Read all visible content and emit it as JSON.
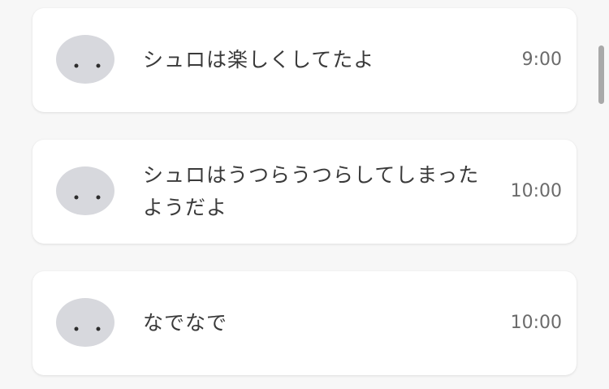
{
  "feed": {
    "items": [
      {
        "message": "シュロは楽しくしてたよ",
        "time": "9:00"
      },
      {
        "message": "シュロはうつらうつらしてしまったようだよ",
        "time": "10:00"
      },
      {
        "message": "なでなで",
        "time": "10:00"
      }
    ]
  },
  "theme": {
    "background": "#f7f7f7",
    "card": "#ffffff",
    "avatar": "#d7d8dd",
    "avatar_eyes": "#2d2d2d",
    "text": "#3a3a3a",
    "time_text": "#6b6b6b",
    "scrollbar": "#a9a9a9"
  }
}
